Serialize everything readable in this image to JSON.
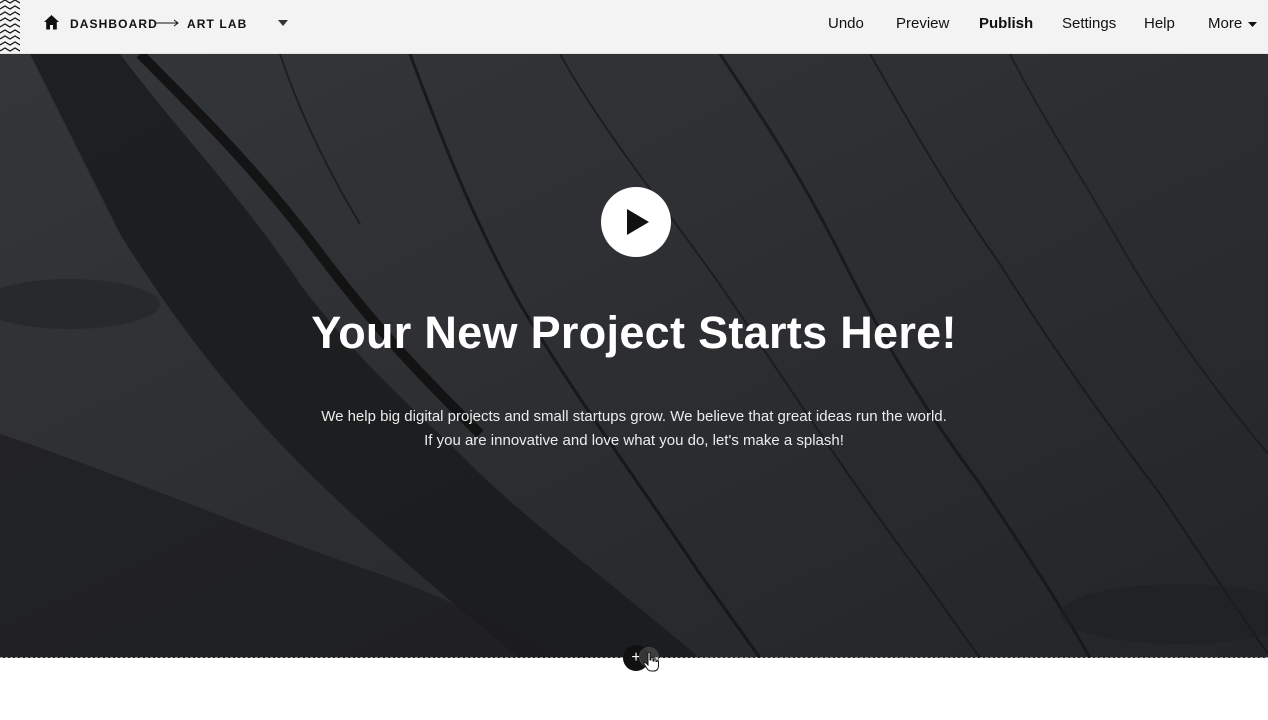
{
  "topbar": {
    "breadcrumb": {
      "home_icon": "home-icon",
      "dashboard": "DASHBOARD",
      "separator_icon": "long-arrow-right-icon",
      "project": "ART LAB",
      "project_dropdown_icon": "caret-down-icon"
    },
    "menu": {
      "undo": "Undo",
      "preview": "Preview",
      "publish": "Publish",
      "settings": "Settings",
      "help": "Help",
      "more": "More",
      "more_icon": "caret-down-icon"
    }
  },
  "hero": {
    "play_icon": "play-icon",
    "title": "Your New Project Starts Here!",
    "subtitle_line1": "We help big digital projects and small startups grow. We believe that great ideas run the world.",
    "subtitle_line2": "If you are innovative and love what you do, let's make a splash!"
  },
  "editor": {
    "add_block_label": "+",
    "add_block_icon": "plus-icon",
    "cursor_icon": "hand-pointer-icon"
  },
  "colors": {
    "topbar_bg": "#f3f3f3",
    "hero_bg": "#2b2d30",
    "text_dark": "#111111",
    "text_light": "#ffffff"
  }
}
